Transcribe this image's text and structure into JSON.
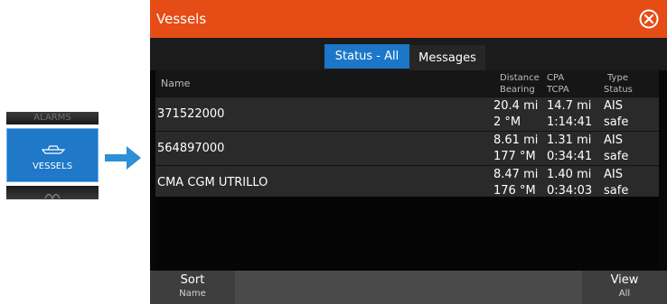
{
  "menu": {
    "alarms_label": "ALARMS",
    "vessels_label": "VESSELS"
  },
  "dialog": {
    "title": "Vessels",
    "close_icon": "close-circle-icon",
    "tabs": [
      {
        "label": "Status - All",
        "active": true
      },
      {
        "label": "Messages",
        "active": false
      }
    ],
    "columns": {
      "name": "Name",
      "distance": "Distance",
      "bearing": "Bearing",
      "cpa": "CPA",
      "tcpa": "TCPA",
      "type": "Type",
      "status": "Status"
    },
    "rows": [
      {
        "name": "371522000",
        "distance": "20.4 mi",
        "bearing": "2 °M",
        "cpa": "14.7 mi",
        "tcpa": "1:14:41",
        "type": "AIS",
        "status": "safe"
      },
      {
        "name": "564897000",
        "distance": "8.61 mi",
        "bearing": "177 °M",
        "cpa": "1.31 mi",
        "tcpa": "0:34:41",
        "type": "AIS",
        "status": "safe"
      },
      {
        "name": "CMA CGM UTRILLO",
        "distance": "8.47 mi",
        "bearing": "176 °M",
        "cpa": "1.40 mi",
        "tcpa": "0:34:03",
        "type": "AIS",
        "status": "safe"
      }
    ],
    "softkeys": {
      "sort_label": "Sort",
      "sort_value": "Name",
      "view_label": "View",
      "view_value": "All"
    }
  },
  "colors": {
    "title_bar": "#e64c16",
    "accent": "#1c77c9"
  }
}
